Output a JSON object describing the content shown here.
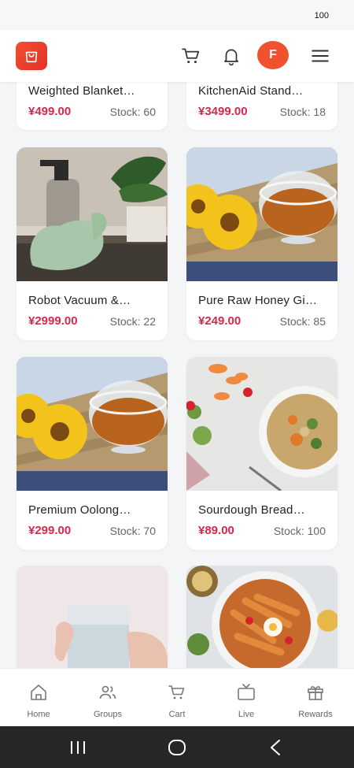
{
  "status": {
    "battery": "100"
  },
  "header": {
    "logo_icon": "shopping-bag-icon",
    "avatar_letter": "F",
    "colors": {
      "brand": "#ee432d",
      "avatar": "#f2512f"
    }
  },
  "products": [
    {
      "name": "Weighted Blanket…",
      "price": "¥499.00",
      "stock": "Stock: 60"
    },
    {
      "name": "KitchenAid Stand…",
      "price": "¥3499.00",
      "stock": "Stock: 18"
    },
    {
      "name": "Robot Vacuum &…",
      "price": "¥2999.00",
      "stock": "Stock: 22"
    },
    {
      "name": "Pure Raw Honey Gi…",
      "price": "¥249.00",
      "stock": "Stock: 85"
    },
    {
      "name": "Premium Oolong…",
      "price": "¥299.00",
      "stock": "Stock: 70"
    },
    {
      "name": "Sourdough Bread…",
      "price": "¥89.00",
      "stock": "Stock: 100"
    },
    {
      "name": "",
      "price": "",
      "stock": ""
    },
    {
      "name": "",
      "price": "",
      "stock": ""
    }
  ],
  "nav": [
    {
      "label": "Home",
      "icon": "home-icon"
    },
    {
      "label": "Groups",
      "icon": "users-icon"
    },
    {
      "label": "Cart",
      "icon": "cart-icon"
    },
    {
      "label": "Live",
      "icon": "tv-icon"
    },
    {
      "label": "Rewards",
      "icon": "gift-icon"
    }
  ],
  "colors": {
    "price": "#d8274c",
    "accent": "#ee432d"
  }
}
